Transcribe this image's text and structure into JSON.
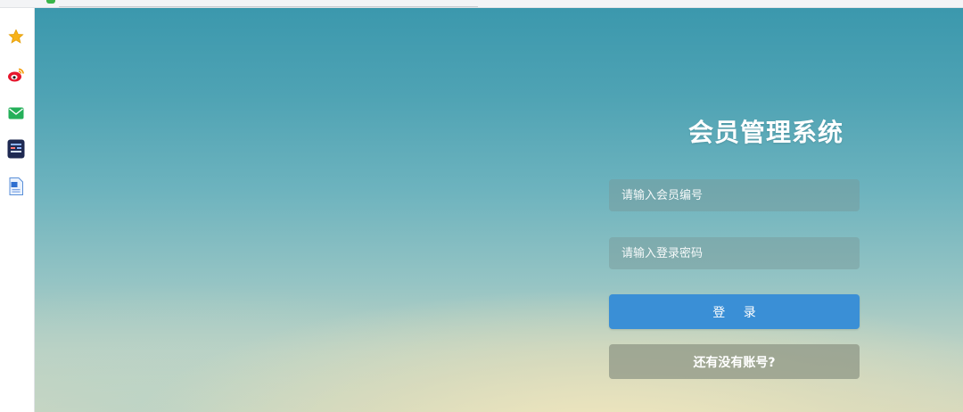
{
  "title": "会员管理系统",
  "form": {
    "member_id_placeholder": "请输入会员编号",
    "password_placeholder": "请输入登录密码",
    "member_id_value": "",
    "password_value": "",
    "login_label": "登 录",
    "register_label": "还有没有账号?"
  },
  "sidebar": {
    "items": [
      {
        "icon": "star-icon"
      },
      {
        "icon": "weibo-icon"
      },
      {
        "icon": "mail-icon"
      },
      {
        "icon": "app-icon"
      },
      {
        "icon": "document-icon"
      }
    ]
  },
  "colors": {
    "login_button": "#3a8fd6",
    "accent_green": "#39b54a"
  }
}
